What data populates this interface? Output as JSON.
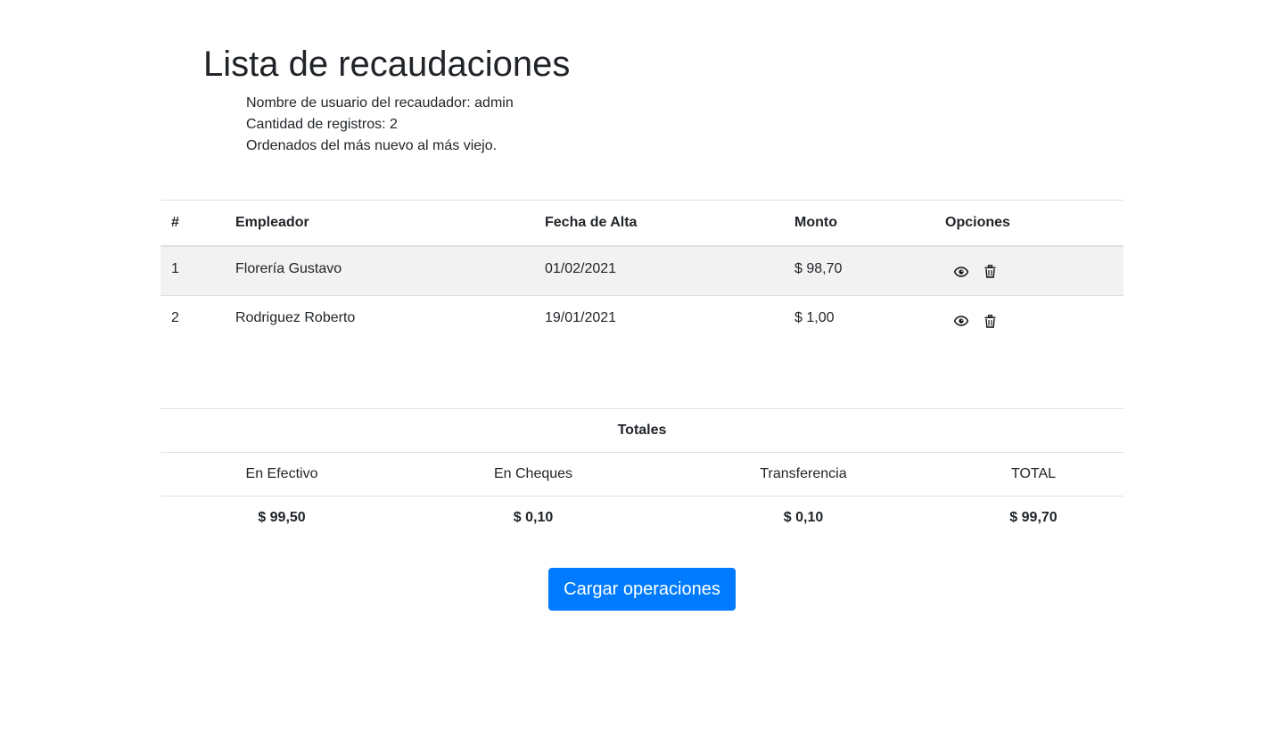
{
  "page": {
    "title": "Lista de recaudaciones",
    "meta": {
      "collector": "Nombre de usuario del recaudador: admin",
      "count": "Cantidad de registros: 2",
      "order": "Ordenados del más nuevo al más viejo."
    }
  },
  "records": {
    "headers": {
      "num": "#",
      "employer": "Empleador",
      "date": "Fecha de Alta",
      "amount": "Monto",
      "options": "Opciones"
    },
    "rows": [
      {
        "num": "1",
        "employer": "Florería Gustavo",
        "date": "01/02/2021",
        "amount": "$ 98,70"
      },
      {
        "num": "2",
        "employer": "Rodriguez Roberto",
        "date": "19/01/2021",
        "amount": "$ 1,00"
      }
    ],
    "icons": {
      "view": "eye-icon",
      "delete": "trash-icon"
    }
  },
  "totals": {
    "title": "Totales",
    "labels": {
      "cash": "En Efectivo",
      "checks": "En Cheques",
      "transfer": "Transferencia",
      "total": "TOTAL"
    },
    "values": {
      "cash": "$ 99,50",
      "checks": "$ 0,10",
      "transfer": "$ 0,10",
      "total": "$ 99,70"
    }
  },
  "actions": {
    "load_label": "Cargar operaciones"
  },
  "colors": {
    "primary": "#007bff",
    "text": "#212529",
    "stripe": "#f2f2f2",
    "border": "#dee2e6"
  }
}
